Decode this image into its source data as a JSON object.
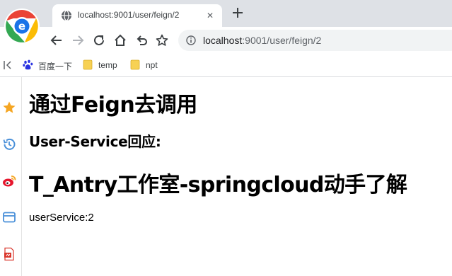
{
  "tab": {
    "title": "localhost:9001/user/feign/2",
    "close_symbol": "✕"
  },
  "toolbar": {
    "url_host": "localhost",
    "url_path": ":9001/user/feign/2"
  },
  "bookmarks": {
    "items": [
      {
        "label": "百度一下",
        "icon": "baidu-paw-icon"
      },
      {
        "label": "temp",
        "icon": "folder-icon"
      },
      {
        "label": "npt",
        "icon": "folder-icon"
      }
    ]
  },
  "sidebar": {
    "icons": [
      "favorites-star-icon",
      "history-icon",
      "weibo-icon",
      "window-icon",
      "pdf-icon"
    ]
  },
  "page": {
    "heading1": "通过Feign去调用",
    "heading3": "User-Service回应:",
    "heading_main": "T_Antry工作室-springcloud动手了解",
    "body_text": "userService:2"
  },
  "colors": {
    "tabstrip_bg": "#dee1e6",
    "omnibox_bg": "#f1f3f4",
    "folder_yellow": "#f7d154",
    "star_orange": "#f5a623",
    "history_blue": "#4a90d9",
    "weibo_red": "#e6162d",
    "pdf_red": "#d9352b"
  }
}
